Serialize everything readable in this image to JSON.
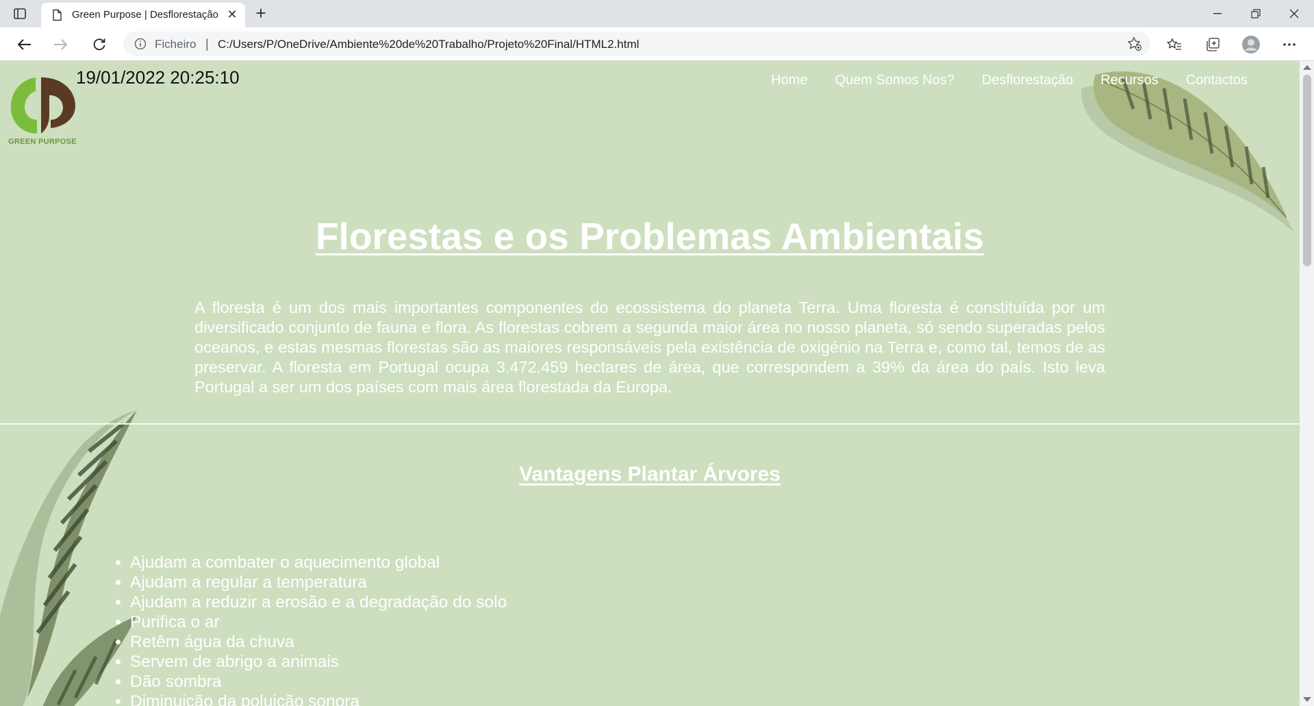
{
  "browser": {
    "tab_title": "Green Purpose | Desflorestação",
    "url_scheme": "Ficheiro",
    "url": "C:/Users/P/OneDrive/Ambiente%20de%20Trabalho/Projeto%20Final/HTML2.html"
  },
  "page": {
    "datetime": "19/01/2022 20:25:10",
    "logo_text": "GREEN PURPOSE",
    "nav": [
      "Home",
      "Quem Somos Nos?",
      "Desflorestação",
      "Recursos",
      "Contactos"
    ],
    "title": "Florestas e os Problemas Ambientais",
    "intro": "A floresta é um dos mais importantes componentes do ecossistema do planeta Terra. Uma floresta é constituída por um diversificado conjunto de fauna e flora. As florestas cobrem a segunda maior área no nosso planeta, só sendo superadas pelos oceanos, e estas mesmas florestas são as maiores responsáveis pela existência de oxigénio na Terra e, como tal, temos de as preservar. A floresta em Portugal ocupa 3.472.459 hectares de área, que correspondem a 39% da área do país. Isto leva Portugal a ser um dos países com mais área florestada da Europa.",
    "section_title": "Vantagens Plantar Árvores",
    "advantages": [
      "Ajudam a combater o aquecimento global",
      "Ajudam a regular a temperatura",
      "Ajudam a reduzir a erosão e a degradação do solo",
      "Purifica o ar",
      "Retêm água da chuva",
      "Servem de abrigo a animais",
      "Dão sombra",
      "Diminuição da poluição sonora"
    ]
  },
  "colors": {
    "page_background": "#cddfbf",
    "logo_green": "#7cbc3c",
    "logo_brown": "#5a3a22"
  }
}
